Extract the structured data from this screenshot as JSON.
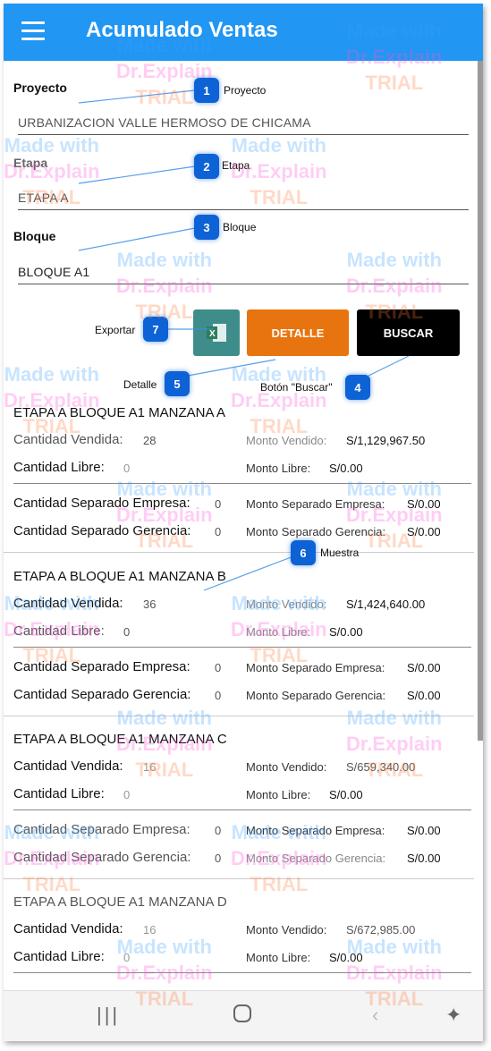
{
  "app": {
    "title": "Acumulado Ventas"
  },
  "form": {
    "proyecto_label": "Proyecto",
    "proyecto_value": "URBANIZACION VALLE HERMOSO DE CHICAMA",
    "etapa_label": "Etapa",
    "etapa_value": "ETAPA A",
    "bloque_label": "Bloque",
    "bloque_value": "BLOQUE A1"
  },
  "buttons": {
    "detalle": "DETALLE",
    "buscar": "BUSCAR",
    "excel_icon": "excel-icon"
  },
  "callouts": [
    {
      "num": "1",
      "label": "Proyecto"
    },
    {
      "num": "2",
      "label": "Etapa"
    },
    {
      "num": "3",
      "label": "Bloque"
    },
    {
      "num": "4",
      "label": "Botón \"Buscar\""
    },
    {
      "num": "5",
      "label": "Detalle"
    },
    {
      "num": "6",
      "label": "Muestra"
    },
    {
      "num": "7",
      "label": "Exportar"
    }
  ],
  "labels": {
    "cantidad_vendida": "Cantidad Vendida:",
    "cantidad_libre": "Cantidad Libre:",
    "monto_vendido": "Monto Vendido:",
    "monto_libre": "Monto Libre:",
    "cantidad_separado_empresa": "Cantidad Separado Empresa:",
    "cantidad_separado_gerencia": "Cantidad Separado Gerencia:",
    "monto_separado_empresa": "Monto Separado Empresa:",
    "monto_separado_gerencia": "Monto Separado Gerencia:"
  },
  "cards": [
    {
      "title": "ETAPA A BLOQUE A1 MANZANA A",
      "cantidad_vendida": "28",
      "monto_vendido": "S/1,129,967.50",
      "cantidad_libre": "0",
      "monto_libre": "S/0.00",
      "sep_empresa": "0",
      "monto_sep_empresa": "S/0.00",
      "sep_gerencia": "0",
      "monto_sep_gerencia": "S/0.00"
    },
    {
      "title": "ETAPA A BLOQUE A1 MANZANA B",
      "cantidad_vendida": "36",
      "monto_vendido": "S/1,424,640.00",
      "cantidad_libre": "0",
      "monto_libre": "S/0.00",
      "sep_empresa": "0",
      "monto_sep_empresa": "S/0.00",
      "sep_gerencia": "0",
      "monto_sep_gerencia": "S/0.00"
    },
    {
      "title": "ETAPA A BLOQUE A1 MANZANA C",
      "cantidad_vendida": "16",
      "monto_vendido": "S/659,340.00",
      "cantidad_libre": "0",
      "monto_libre": "S/0.00",
      "sep_empresa": "0",
      "monto_sep_empresa": "S/0.00",
      "sep_gerencia": "0",
      "monto_sep_gerencia": "S/0.00"
    },
    {
      "title": "ETAPA A BLOQUE A1 MANZANA D",
      "cantidad_vendida": "16",
      "monto_vendido": "S/672,985.00",
      "cantidad_libre": "0",
      "monto_libre": "S/0.00"
    }
  ],
  "watermark": {
    "line1": "Made with",
    "line2": "Dr.Explain",
    "line3": "TRIAL"
  },
  "navbar": {
    "recents_icon": "recents-icon",
    "home_icon": "home-icon",
    "back_icon": "back-icon",
    "accessibility_icon": "accessibility-icon"
  },
  "colors": {
    "appbar": "#2196f3",
    "detalle": "#e8740f",
    "buscar": "#000000",
    "excel": "#3f8d8a",
    "callout": "#0d62d6"
  }
}
